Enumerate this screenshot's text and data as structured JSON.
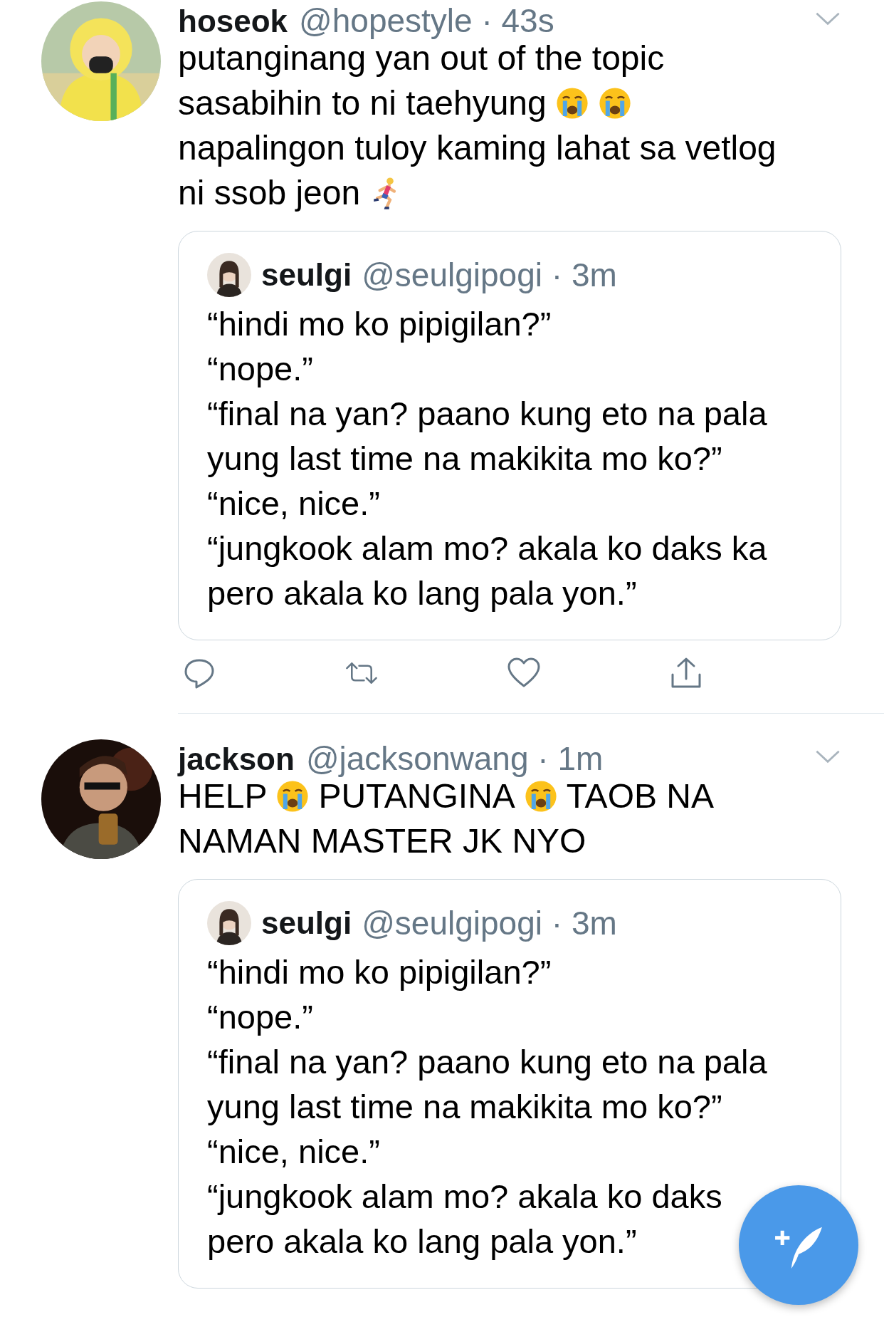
{
  "tweets": [
    {
      "name": "hoseok",
      "handle": "@hopestyle · 43s",
      "body": [
        [
          {
            "kind": "text",
            "text": "putanginang yan out of the topic"
          }
        ],
        [
          {
            "kind": "text",
            "text": "sasabihin to ni taehyung"
          },
          {
            "kind": "crying"
          },
          {
            "kind": "crying"
          }
        ],
        [
          {
            "kind": "text",
            "text": "napalingon tuloy kaming lahat sa vetlog"
          }
        ],
        [
          {
            "kind": "text",
            "text": "ni ssob jeon"
          },
          {
            "kind": "runner"
          }
        ]
      ],
      "quote": {
        "name": "seulgi",
        "handle": "@seulgipogi · 3m",
        "lines": [
          "“hindi mo ko pipigilan?”",
          "“nope.”",
          "“final na yan? paano kung eto na pala",
          "yung last time na makikita mo ko?”",
          "“nice, nice.”",
          "“jungkook alam mo? akala ko daks ka",
          "pero akala ko lang pala yon.”"
        ]
      },
      "actions_shown": true
    },
    {
      "name": "jackson",
      "handle": "@jacksonwang · 1m",
      "body": [
        [
          {
            "kind": "text",
            "text": "HELP"
          },
          {
            "kind": "crying"
          },
          {
            "kind": "text",
            "text": "PUTANGINA"
          },
          {
            "kind": "crying"
          },
          {
            "kind": "text",
            "text": "TAOB NA"
          }
        ],
        [
          {
            "kind": "text",
            "text": "NAMAN MASTER JK NYO"
          }
        ]
      ],
      "quote": {
        "name": "seulgi",
        "handle": "@seulgipogi · 3m",
        "lines": [
          "“hindi mo ko pipigilan?”",
          "“nope.”",
          "“final na yan? paano kung eto na pala",
          "yung last time na makikita mo ko?”",
          "“nice, nice.”",
          "“jungkook alam mo? akala ko daks",
          "pero akala ko lang pala yon.”"
        ]
      },
      "actions_shown": false
    }
  ]
}
